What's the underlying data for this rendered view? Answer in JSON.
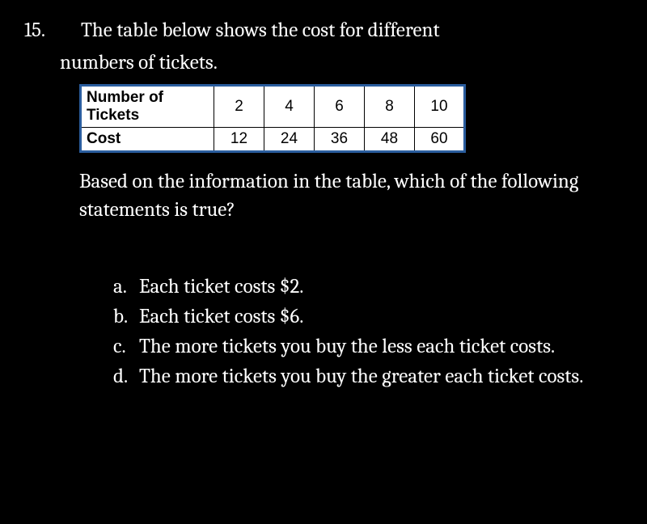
{
  "question": {
    "number": "15.",
    "intro_line1": "The table below shows the cost for different",
    "intro_line2": "numbers of tickets.",
    "prompt": "Based on the information in the table, which of the following statements is true?"
  },
  "chart_data": {
    "type": "table",
    "row_headers": [
      "Number of Tickets",
      "Cost"
    ],
    "rows": [
      [
        2,
        4,
        6,
        8,
        10
      ],
      [
        12,
        24,
        36,
        48,
        60
      ]
    ]
  },
  "options": [
    {
      "letter": "a.",
      "text": "Each ticket costs $2."
    },
    {
      "letter": "b.",
      "text": "Each ticket costs $6."
    },
    {
      "letter": "c.",
      "text": "The more tickets you buy the less each ticket costs."
    },
    {
      "letter": "d.",
      "text": "The more tickets you buy the greater each ticket costs."
    }
  ]
}
